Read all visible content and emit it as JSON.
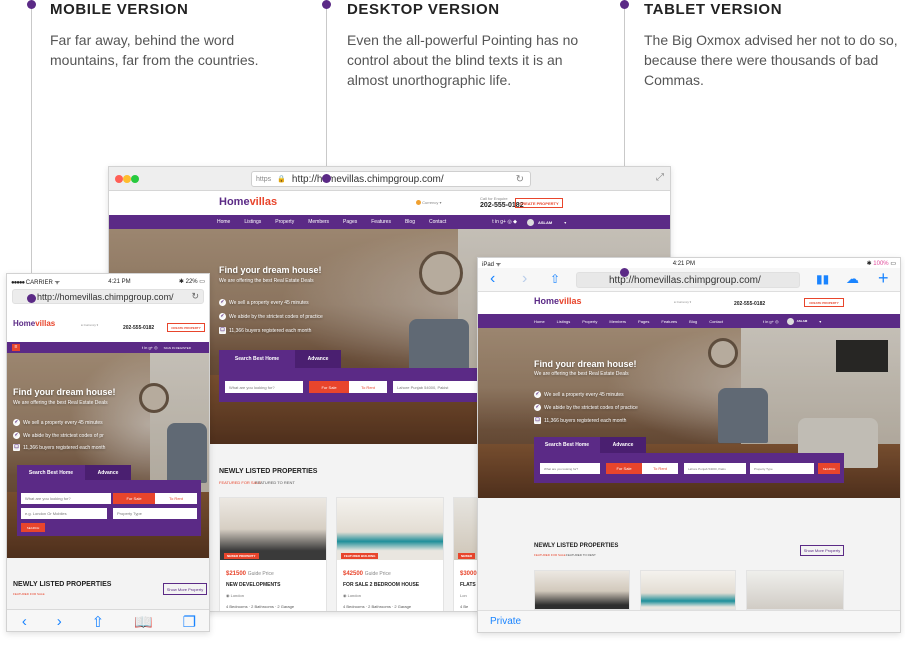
{
  "features": [
    {
      "title": "MOBILE VERSION",
      "text": "Far far away, behind the word mountains, far from the countries."
    },
    {
      "title": "DESKTOP VERSION",
      "text": "Even the all-powerful Pointing has no control about the blind texts it is an almost unorthographic life."
    },
    {
      "title": "TABLET VERSION",
      "text": "The Big Oxmox advised her not to do so, because there were thousands of bad Commas."
    }
  ],
  "desktop": {
    "https": "https",
    "url": "http://homevillas.chimpgroup.com/",
    "phone_label": "Call for Enquire",
    "phone": "202-555-0182",
    "create": "CREATE PROPERTY",
    "nav": [
      "Home",
      "Listings",
      "Property",
      "Members",
      "Pages",
      "Features",
      "Blog",
      "Contact"
    ],
    "user": "ASLAM",
    "hero_title": "Find your dream house!",
    "hero_sub": "We are offering the best Real Estate Deals",
    "checks": [
      "We sell a property every 45 minutes",
      "We abide by the strictest codes of practice",
      "11,366 buyers registered each month"
    ],
    "tab_search": "Search Best Home",
    "tab_adv": "Advance",
    "field_what": "What are you looking for?",
    "for_sale": "For Sale",
    "to_rent": "To Rent",
    "location": "Lahore Punjab 54000, Pakist",
    "prop_type": "Prop",
    "section_title": "NEWLY LISTED PROPERTIES",
    "sub1": "FEATURED FOR SALE",
    "sub2": "FEATURED TO RENT",
    "cards": [
      {
        "price": "$21500",
        "price_note": "Guide Price",
        "title": "NEW DEVELOPMENTS",
        "loc": "London",
        "rooms": "4 Bedrooms",
        "baths": "2 Bathrooms",
        "garage": "2 Garage"
      },
      {
        "price": "$42500",
        "price_note": "Guide Price",
        "title": "FOR SALE 2 BEDROOM HOUSE",
        "loc": "London",
        "rooms": "4 Bedrooms",
        "baths": "2 Bathrooms",
        "garage": "2 Garage"
      },
      {
        "price": "$3000",
        "price_note": "",
        "title": "FLATS",
        "loc": "Lon",
        "rooms": "4 Be",
        "baths": "",
        "garage": ""
      }
    ]
  },
  "mobile": {
    "carrier": "CARRIER",
    "time": "4:21 PM",
    "battery": "22%",
    "url": "http://homevillas.chimpgroup.com/",
    "phone": "202-555-0182",
    "create": "CREATE PROPERTY",
    "signin": "SIGN IN REGISTER",
    "hero_title": "Find your dream house!",
    "hero_sub": "We are offering the best Real Estate Deals",
    "checks": [
      "We sell a property every 45 minutes",
      "We abide by the strictest codes of pr",
      "11,366 buyers registered each month"
    ],
    "tab_search": "Search Best Home",
    "tab_adv": "Advance",
    "field_what": "What are you looking for?",
    "for_sale": "For Sale",
    "to_rent": "To Rent",
    "location": "e.g. London Or Mobiles",
    "prop_type": "Property Type",
    "search": "SEARCH",
    "section_title": "NEWLY LISTED PROPERTIES",
    "sub1": "FEATURED FOR SALE",
    "show_more": "Show More Property"
  },
  "tablet": {
    "ipad": "iPad",
    "time": "4:21 PM",
    "battery": "100%",
    "url": "http://homevillas.chimpgroup.com/",
    "phone": "202-555-0182",
    "create": "CREATE PROPERTY",
    "nav": [
      "Home",
      "Listings",
      "Property",
      "Members",
      "Pages",
      "Features",
      "Blog",
      "Contact"
    ],
    "user": "ASLAM",
    "hero_title": "Find your dream house!",
    "hero_sub": "We are offering the best Real Estate Deals",
    "checks": [
      "We sell a property every 45 minutes",
      "We abide by the strictest codes of practice",
      "11,366 buyers registered each month"
    ],
    "tab_search": "Search Best Home",
    "tab_adv": "Advance",
    "field_what": "What are you looking for?",
    "for_sale": "For Sale",
    "to_rent": "To Rent",
    "location": "Lahore Punjab 54000, Pakis",
    "prop_type": "Property Type",
    "search": "SEARCH",
    "section_title": "NEWLY LISTED PROPERTIES",
    "sub1": "FEATURED FOR SALE",
    "sub2": "FEATURED TO RENT",
    "show_more": "Show More Property",
    "private": "Private"
  },
  "colors": {
    "accent": "#5b2a86",
    "brand_red": "#e8452c"
  }
}
